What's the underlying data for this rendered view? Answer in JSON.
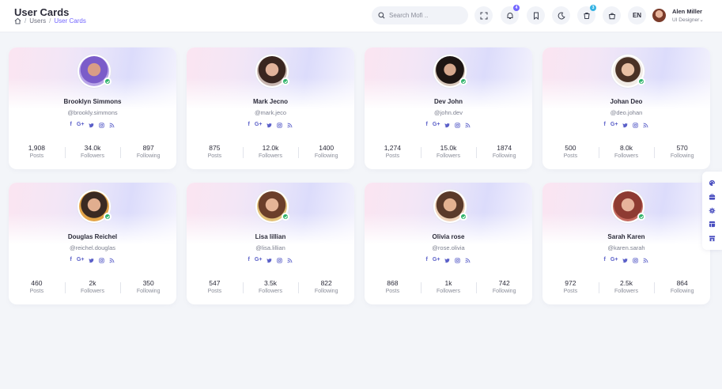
{
  "header": {
    "title": "User Cards",
    "breadcrumb": [
      "Users",
      "User Cards"
    ],
    "breadcrumb_sep": "/",
    "search_placeholder": "Search Mofi ..",
    "lang": "EN",
    "badges": {
      "notifications": "4",
      "cart": "3"
    },
    "user": {
      "name": "Alen Miller",
      "role": "UI Designer"
    },
    "role_caret": "⌄",
    "accent_color": "#7366ff"
  },
  "cards": [
    {
      "name": "Brooklyn Simmons",
      "handle": "@brookly.simmons",
      "posts": "1,908",
      "followers": "34.0k",
      "following": "897"
    },
    {
      "name": "Mark Jecno",
      "handle": "@mark.jeco",
      "posts": "875",
      "followers": "12.0k",
      "following": "1400"
    },
    {
      "name": "Dev John",
      "handle": "@john.dev",
      "posts": "1,274",
      "followers": "15.0k",
      "following": "1874"
    },
    {
      "name": "Johan Deo",
      "handle": "@deo.johan",
      "posts": "500",
      "followers": "8.0k",
      "following": "570"
    },
    {
      "name": "Douglas Reichel",
      "handle": "@reichel.douglas",
      "posts": "460",
      "followers": "2k",
      "following": "350"
    },
    {
      "name": "Lisa lillian",
      "handle": "@lisa.lillian",
      "posts": "547",
      "followers": "3.5k",
      "following": "822"
    },
    {
      "name": "Olivia rose",
      "handle": "@rose.olivia",
      "posts": "868",
      "followers": "1k",
      "following": "742"
    },
    {
      "name": "Sarah Karen",
      "handle": "@karen.sarah",
      "posts": "972",
      "followers": "2.5k",
      "following": "864"
    }
  ],
  "stat_labels": {
    "posts": "Posts",
    "followers": "Followers",
    "following": "Following"
  },
  "social": {
    "facebook": "f",
    "google": "G+"
  },
  "icons": [
    "search-icon",
    "fullscreen-icon",
    "notification-icon",
    "bookmark-icon",
    "moon-icon",
    "cart-icon",
    "bag-icon",
    "home-icon",
    "twitter-icon",
    "instagram-icon",
    "rss-icon",
    "check-icon",
    "palette-icon",
    "layout-icon",
    "gear-icon",
    "grid-icon",
    "store-icon"
  ]
}
